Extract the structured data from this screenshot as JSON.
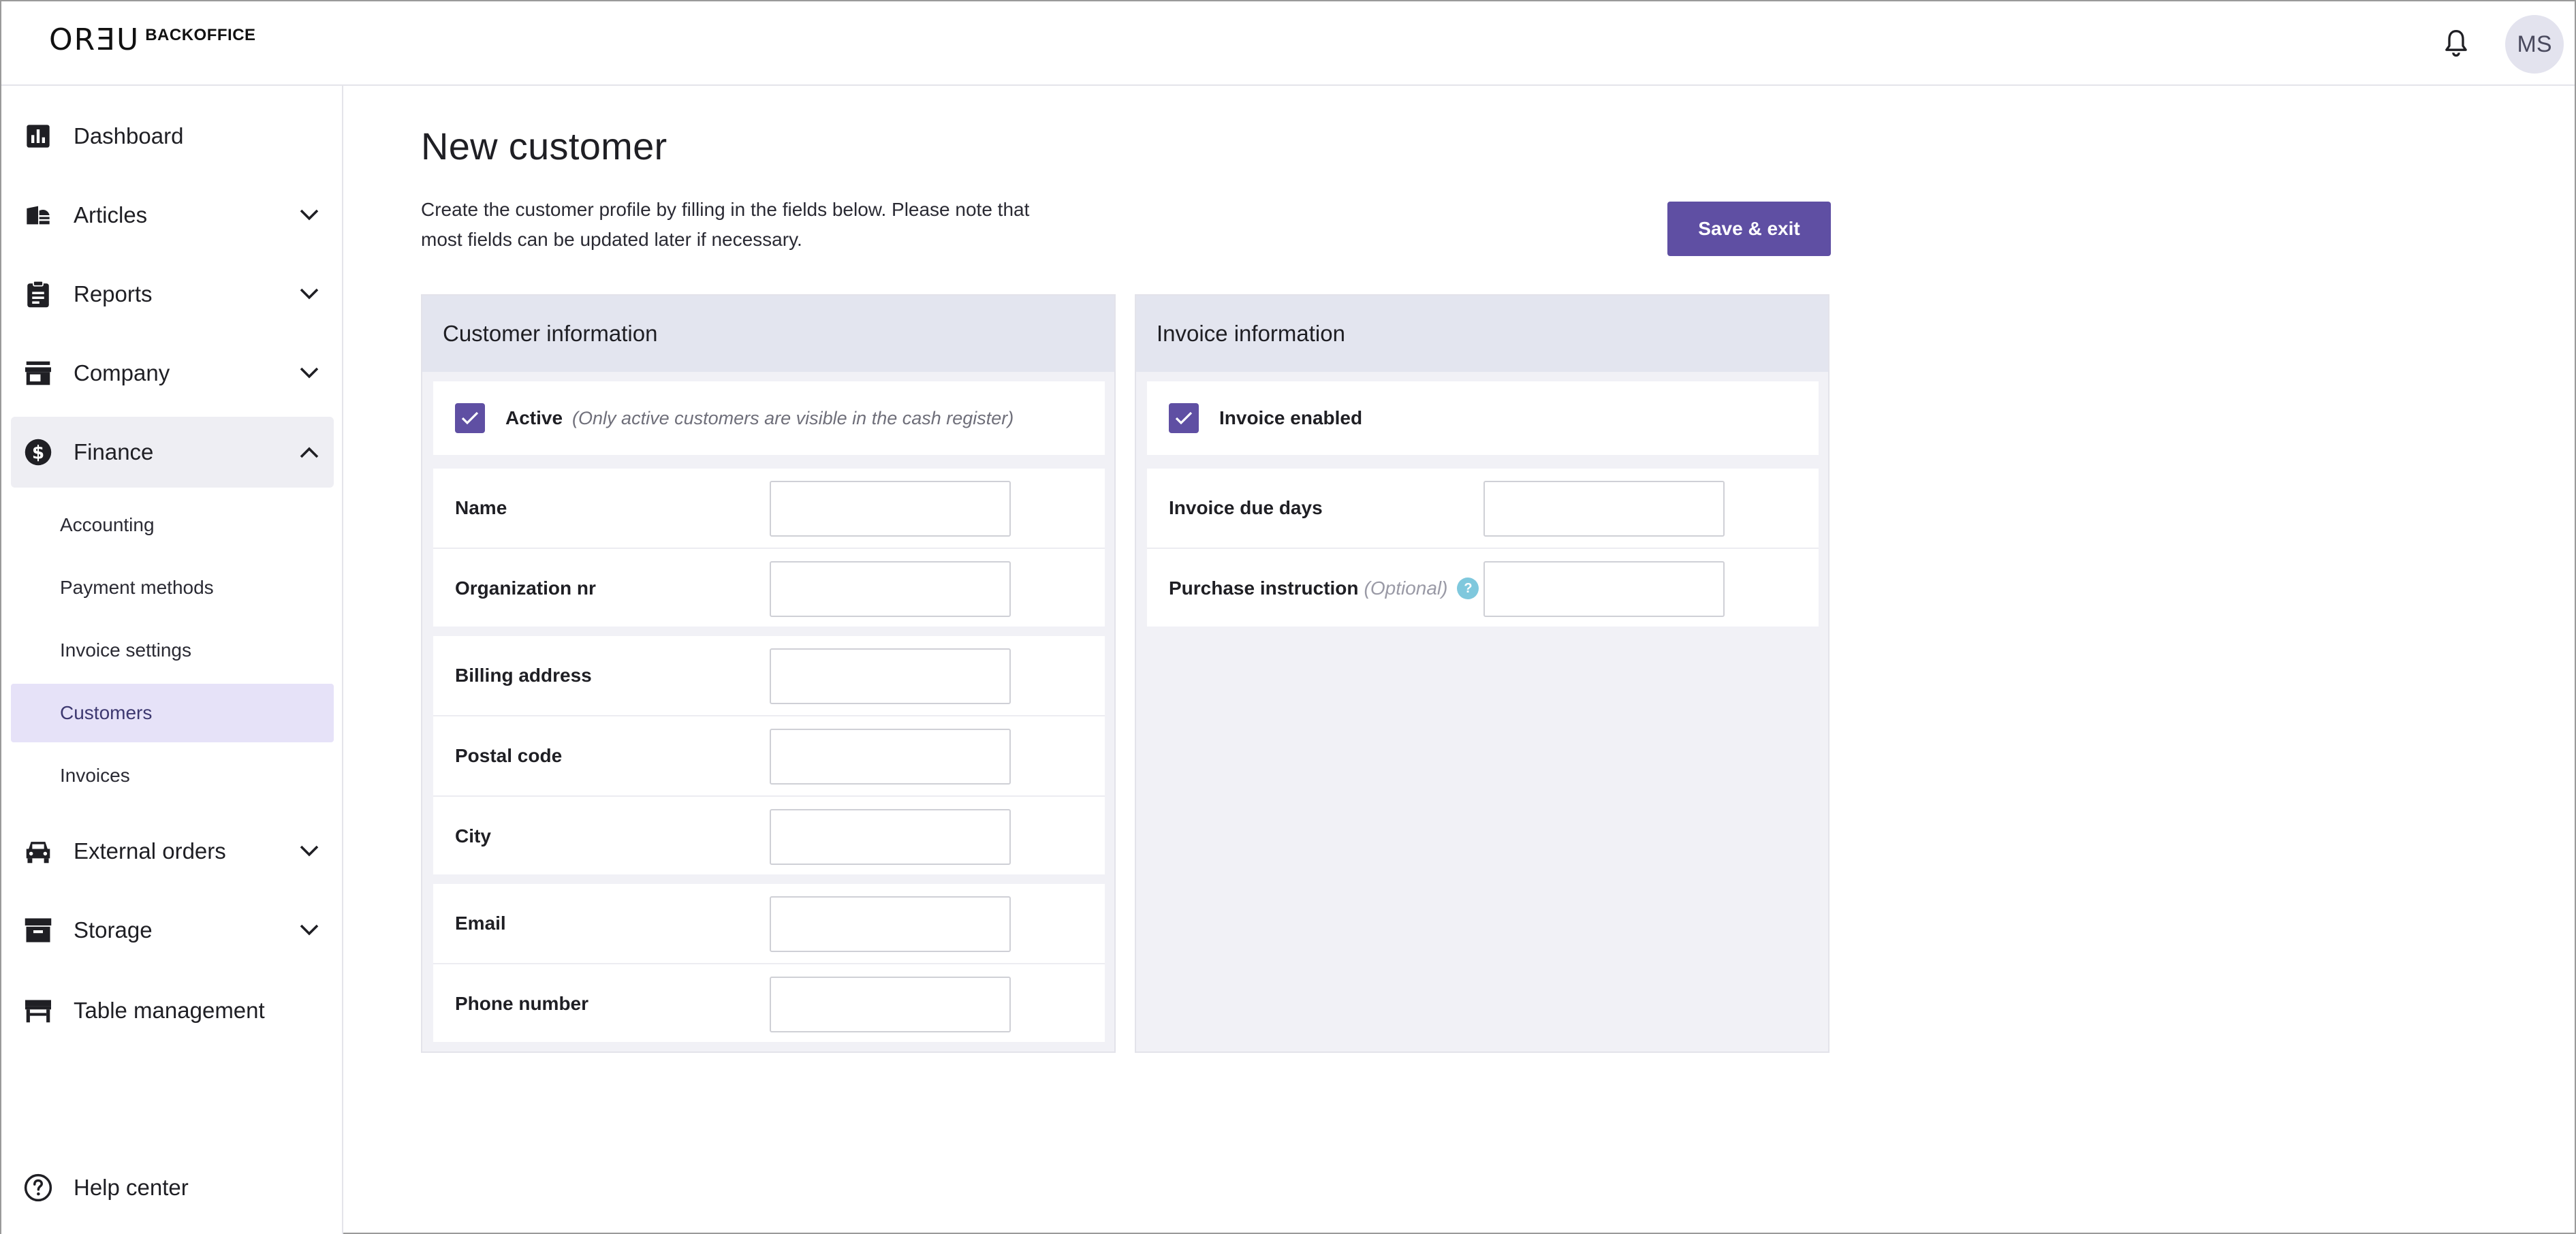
{
  "brand": {
    "logo_mark": "ORƎU",
    "logo_text": "BACKOFFICE"
  },
  "topbar": {
    "notifications_icon": "bell-icon",
    "avatar_initials": "MS"
  },
  "sidebar": {
    "items": [
      {
        "label": "Dashboard",
        "icon": "dashboard-chart-icon"
      },
      {
        "label": "Articles",
        "icon": "articles-icon"
      },
      {
        "label": "Reports",
        "icon": "clipboard-icon"
      },
      {
        "label": "Company",
        "icon": "storefront-icon"
      },
      {
        "label": "Finance",
        "icon": "dollar-circle-icon"
      },
      {
        "label": "External orders",
        "icon": "car-icon"
      },
      {
        "label": "Storage",
        "icon": "archive-box-icon"
      },
      {
        "label": "Table management",
        "icon": "table-icon"
      }
    ],
    "finance_sub": [
      "Accounting",
      "Payment methods",
      "Invoice settings",
      "Customers",
      "Invoices"
    ],
    "active_sub": "Customers",
    "help": {
      "label": "Help center",
      "icon": "question-circle-icon"
    }
  },
  "page": {
    "title": "New customer",
    "description": "Create the customer profile by filling in the fields below. Please note that most fields can be updated later if necessary.",
    "save_label": "Save & exit"
  },
  "customer_panel": {
    "title": "Customer information",
    "active_label": "Active",
    "active_hint": "(Only active customers are visible in the cash register)",
    "active_checked": true,
    "fields": {
      "name": "Name",
      "org_nr": "Organization nr",
      "billing_address": "Billing address",
      "postal_code": "Postal code",
      "city": "City",
      "email": "Email",
      "phone": "Phone number"
    }
  },
  "invoice_panel": {
    "title": "Invoice information",
    "enabled_label": "Invoice enabled",
    "enabled_checked": true,
    "fields": {
      "due_days": "Invoice due days",
      "purchase_instruction": "Purchase instruction",
      "optional": "(Optional)",
      "help": "?"
    }
  },
  "colors": {
    "accent": "#5f4fa3",
    "active_bg": "#e6e2f8",
    "panel_header": "#e3e5ef"
  }
}
